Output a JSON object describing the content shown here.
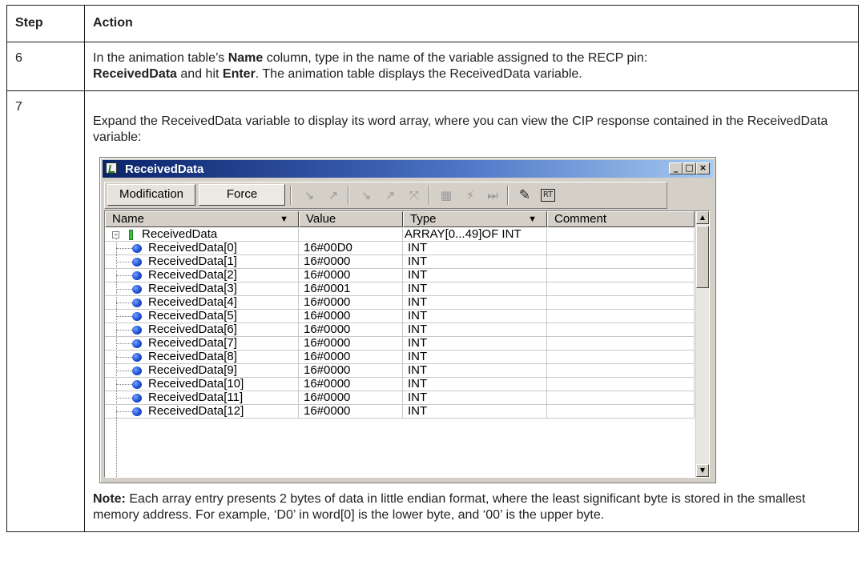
{
  "table": {
    "header_step": "Step",
    "header_action": "Action",
    "rows": [
      {
        "step": "6",
        "text_1": "In the animation table’s ",
        "bold_1": "Name",
        "text_2": " column, type in the name of the variable assigned to the RECP pin:",
        "bold_2": "ReceivedData",
        "text_3": " and hit ",
        "bold_3": "Enter",
        "text_4": ". The animation table displays the ReceivedData variable."
      },
      {
        "step": "7",
        "intro": "Expand the ReceivedData variable to display its word array, where you can view the CIP response contained in the ReceivedData variable:",
        "note_label": "Note:",
        "note_text": " Each array entry presents 2 bytes of data in little endian format, where the least significant byte is stored in the smallest memory address. For example, ‘D0’ in word[0] is the lower byte, and ‘00’ is the upper byte."
      }
    ]
  },
  "window": {
    "title": "ReceivedData",
    "controls": {
      "minimize": "_",
      "maximize": "□",
      "close": "×"
    },
    "toolbar": {
      "modification_label": "Modification",
      "force_label": "Force",
      "icons": [
        {
          "name": "set-value-icon",
          "glyph": "↘"
        },
        {
          "name": "reset-value-icon",
          "glyph": "↗"
        },
        {
          "name": "force-set-icon",
          "glyph": "↘"
        },
        {
          "name": "force-reset-icon",
          "glyph": "↗"
        },
        {
          "name": "unforce-icon",
          "glyph": "⤧"
        },
        {
          "name": "grid-icon",
          "glyph": "▦"
        },
        {
          "name": "lightning-icon",
          "glyph": "⚡"
        },
        {
          "name": "step-icon",
          "glyph": "⏭"
        },
        {
          "name": "edit-icon",
          "glyph": "✎"
        },
        {
          "name": "rt-icon",
          "glyph": "RT"
        }
      ]
    },
    "columns": {
      "name": "Name",
      "value": "Value",
      "type": "Type",
      "comment": "Comment"
    },
    "root": {
      "name": "ReceivedData",
      "value": "",
      "type": "ARRAY[0...49]OF INT",
      "expander": "−"
    },
    "items": [
      {
        "name": "ReceivedData[0]",
        "value": "16#00D0",
        "type": "INT"
      },
      {
        "name": "ReceivedData[1]",
        "value": "16#0000",
        "type": "INT"
      },
      {
        "name": "ReceivedData[2]",
        "value": "16#0000",
        "type": "INT"
      },
      {
        "name": "ReceivedData[3]",
        "value": "16#0001",
        "type": "INT"
      },
      {
        "name": "ReceivedData[4]",
        "value": "16#0000",
        "type": "INT"
      },
      {
        "name": "ReceivedData[5]",
        "value": "16#0000",
        "type": "INT"
      },
      {
        "name": "ReceivedData[6]",
        "value": "16#0000",
        "type": "INT"
      },
      {
        "name": "ReceivedData[7]",
        "value": "16#0000",
        "type": "INT"
      },
      {
        "name": "ReceivedData[8]",
        "value": "16#0000",
        "type": "INT"
      },
      {
        "name": "ReceivedData[9]",
        "value": "16#0000",
        "type": "INT"
      },
      {
        "name": "ReceivedData[10]",
        "value": "16#0000",
        "type": "INT"
      },
      {
        "name": "ReceivedData[11]",
        "value": "16#0000",
        "type": "INT"
      },
      {
        "name": "ReceivedData[12]",
        "value": "16#0000",
        "type": "INT"
      }
    ],
    "scroll": {
      "up": "▲",
      "down": "▼"
    }
  },
  "colors": {
    "title_bar": "#0a246a",
    "item_icon": "#1d4fd6",
    "root_icon": "#3fbf3f"
  }
}
